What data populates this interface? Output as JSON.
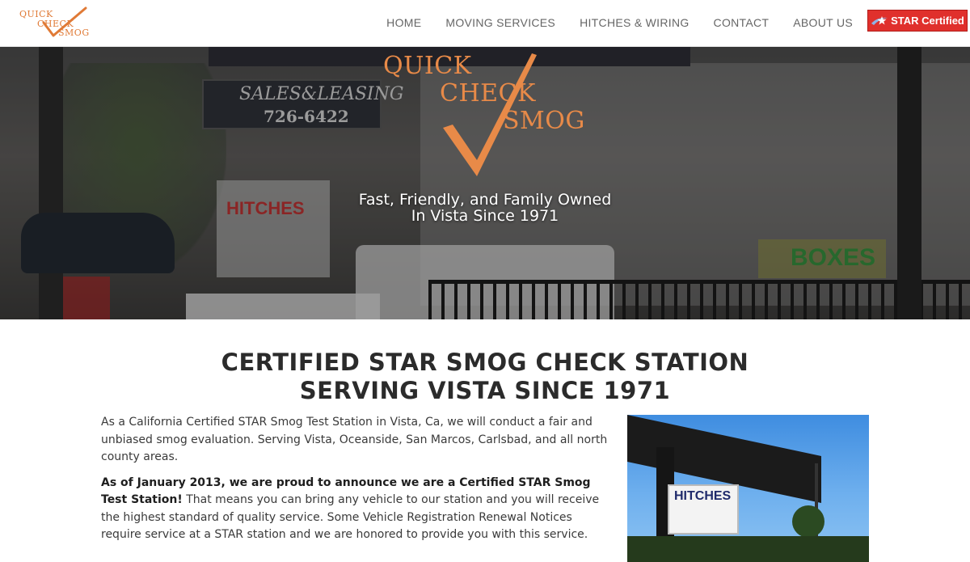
{
  "header": {
    "logo": {
      "line1": "QUICK",
      "line2": "CHECK",
      "line3": "SMOG"
    },
    "nav": [
      {
        "label": "HOME"
      },
      {
        "label": "MOVING SERVICES"
      },
      {
        "label": "HITCHES & WIRING"
      },
      {
        "label": "CONTACT"
      },
      {
        "label": "ABOUT US"
      }
    ],
    "badge": {
      "label": "STAR Certified",
      "icon": "star-icon",
      "color": "#e0302c"
    }
  },
  "hero": {
    "logo": {
      "line1": "QUICK",
      "line2": "CHECK",
      "line3": "SMOG",
      "icon": "checkmark-icon",
      "color": "#e88a48"
    },
    "tagline_line1": "Fast, Friendly, and Family Owned",
    "tagline_line2": "In Vista Since 1971",
    "background_signs": {
      "sales": "SALES&LEASING",
      "phone": "726-6422",
      "hitches": "HITCHES",
      "boxes": "BOXES"
    }
  },
  "main": {
    "headline_line1": "CERTIFIED STAR SMOG CHECK STATION",
    "headline_line2": "SERVING VISTA SINCE 1971",
    "paragraph1": "As a California Certified STAR Smog Test Station in Vista, Ca, we will conduct a fair and unbiased smog evaluation. Serving Vista, Oceanside, San Marcos, Carlsbad, and all north county areas.",
    "paragraph2_bold": "As of January 2013, we are proud to announce we are a Certified STAR Smog Test Station!",
    "paragraph2_rest": " That means you can bring any vehicle to our station and you will receive the highest standard of quality service. Some Vehicle Registration Renewal Notices require service at a STAR station and we are honored to provide you with this service.",
    "photo_sign": "HITCHES"
  },
  "colors": {
    "accent_orange": "#e07a36",
    "badge_red": "#e0302c",
    "heading": "#2b2b2b"
  }
}
